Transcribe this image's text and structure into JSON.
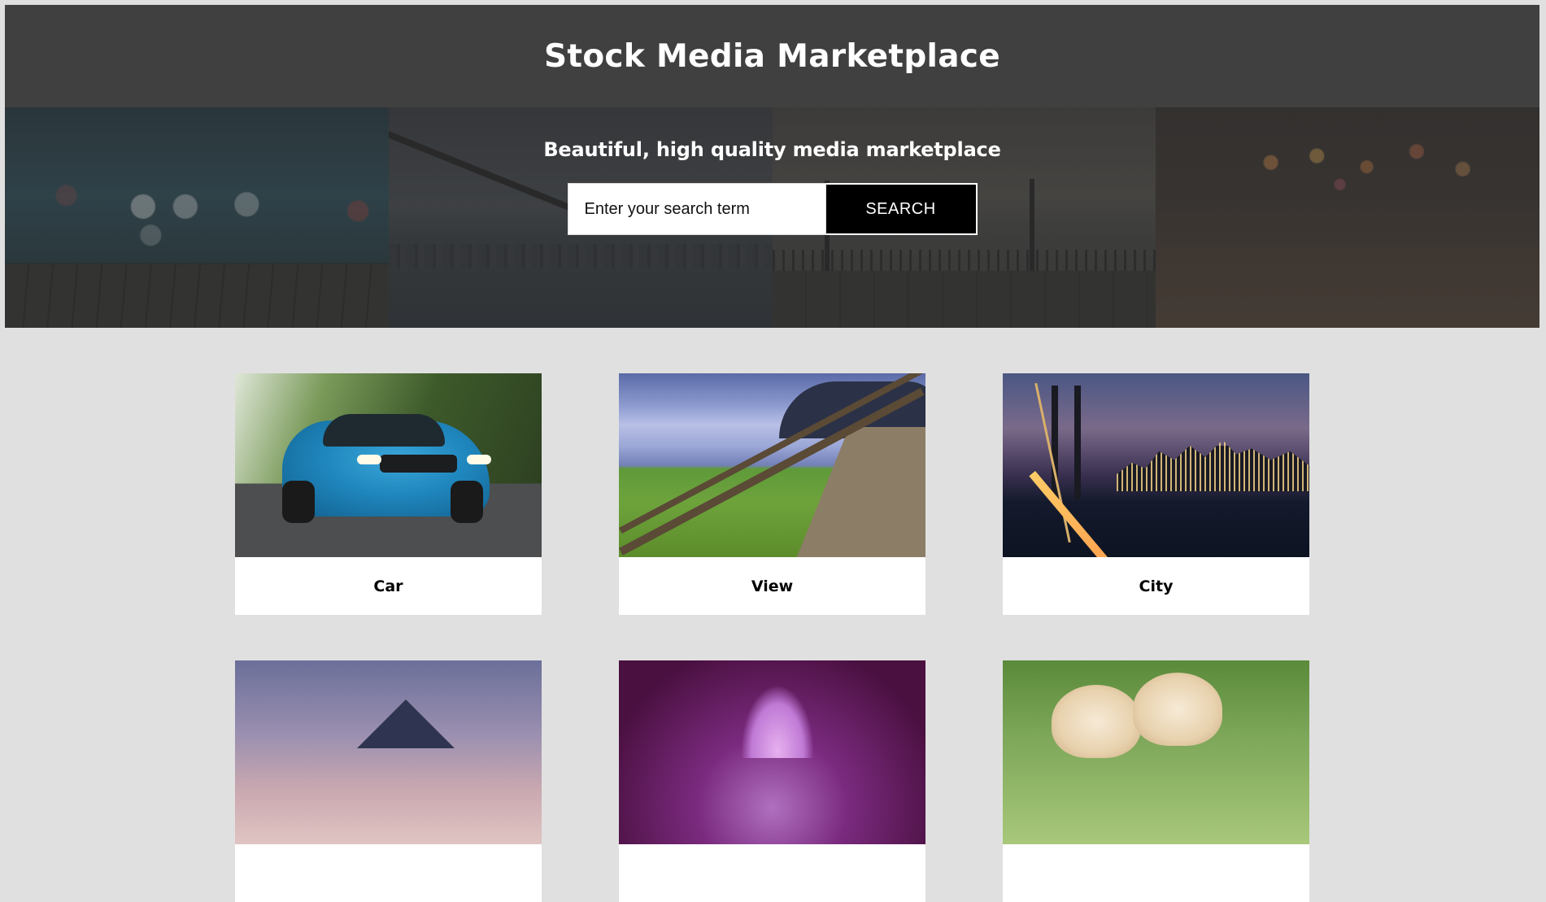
{
  "header": {
    "title": "Stock Media Marketplace"
  },
  "hero": {
    "tagline": "Beautiful, high quality media marketplace",
    "search": {
      "placeholder": "Enter your search term",
      "value": "",
      "button_label": "SEARCH"
    }
  },
  "gallery": {
    "items": [
      {
        "label": "Car"
      },
      {
        "label": "View"
      },
      {
        "label": "City"
      },
      {
        "label": ""
      },
      {
        "label": ""
      },
      {
        "label": ""
      }
    ]
  },
  "colors": {
    "page_background": "#e0e0e0",
    "header_background": "#404040",
    "button_background": "#000000",
    "card_background": "#ffffff"
  }
}
